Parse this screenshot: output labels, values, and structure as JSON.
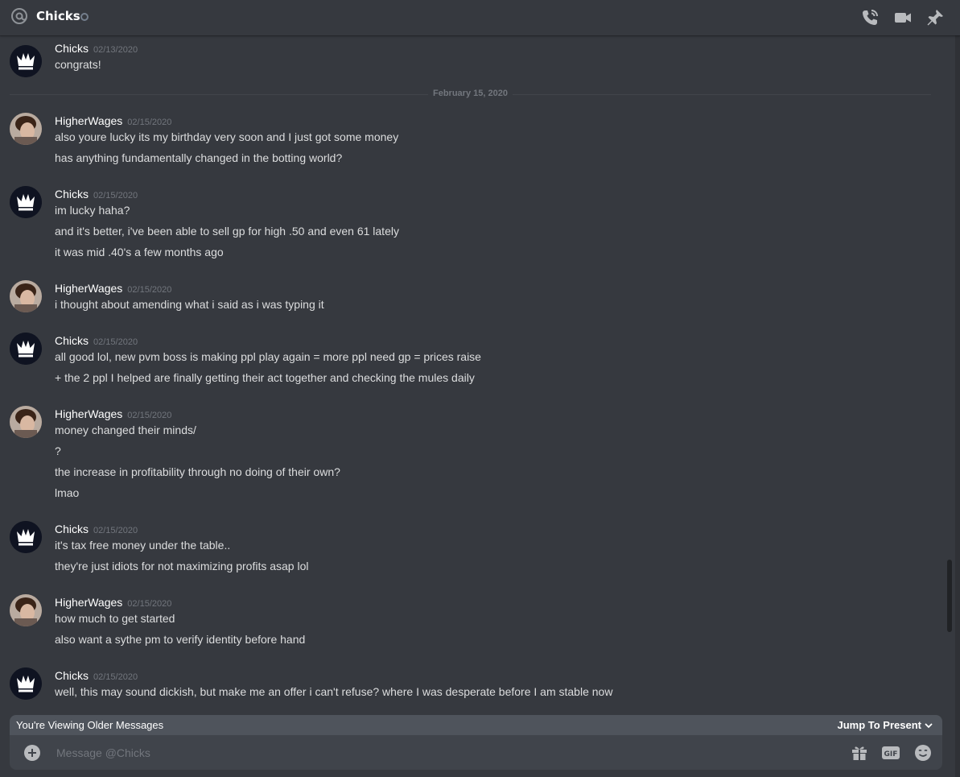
{
  "header": {
    "channel_name": "Chicks"
  },
  "date_divider": "February 15, 2020",
  "messages": [
    {
      "author": "Chicks",
      "timestamp": "02/13/2020",
      "lines": [
        "congrats!"
      ]
    },
    {
      "author": "HigherWages",
      "timestamp": "02/15/2020",
      "lines": [
        "also youre lucky its my birthday very soon and I just got some money",
        "has anything fundamentally changed in the botting world?"
      ]
    },
    {
      "author": "Chicks",
      "timestamp": "02/15/2020",
      "lines": [
        "im lucky haha?",
        "and it's better, i've been able to sell gp for high .50 and even 61 lately",
        "it was mid .40's a few months ago"
      ]
    },
    {
      "author": "HigherWages",
      "timestamp": "02/15/2020",
      "lines": [
        "i thought about amending what i said as i was typing it"
      ]
    },
    {
      "author": "Chicks",
      "timestamp": "02/15/2020",
      "lines": [
        "all good lol, new pvm boss is making ppl play again = more ppl need gp = prices raise",
        "+ the 2 ppl I helped are finally getting their act together and checking the mules daily"
      ]
    },
    {
      "author": "HigherWages",
      "timestamp": "02/15/2020",
      "lines": [
        "money changed their minds/",
        "?",
        "the increase in profitability through no doing of their own?",
        "lmao"
      ]
    },
    {
      "author": "Chicks",
      "timestamp": "02/15/2020",
      "lines": [
        "it's tax free money under the table..",
        "they're just idiots for not maximizing profits asap lol"
      ]
    },
    {
      "author": "HigherWages",
      "timestamp": "02/15/2020",
      "lines": [
        "how much to get started",
        "also want a sythe pm to verify identity before hand"
      ]
    },
    {
      "author": "Chicks",
      "timestamp": "02/15/2020",
      "lines": [
        "well, this may sound dickish, but make me an offer i can't refuse? where I was desperate before I am stable now"
      ]
    }
  ],
  "older_bar": {
    "text": "You're Viewing Older Messages",
    "jump_label": "Jump To Present"
  },
  "composer": {
    "placeholder": "Message @Chicks"
  },
  "colors": {
    "background": "#36393f",
    "username": "#ffffff",
    "timestamp": "#72767d",
    "text": "#dcddde"
  }
}
